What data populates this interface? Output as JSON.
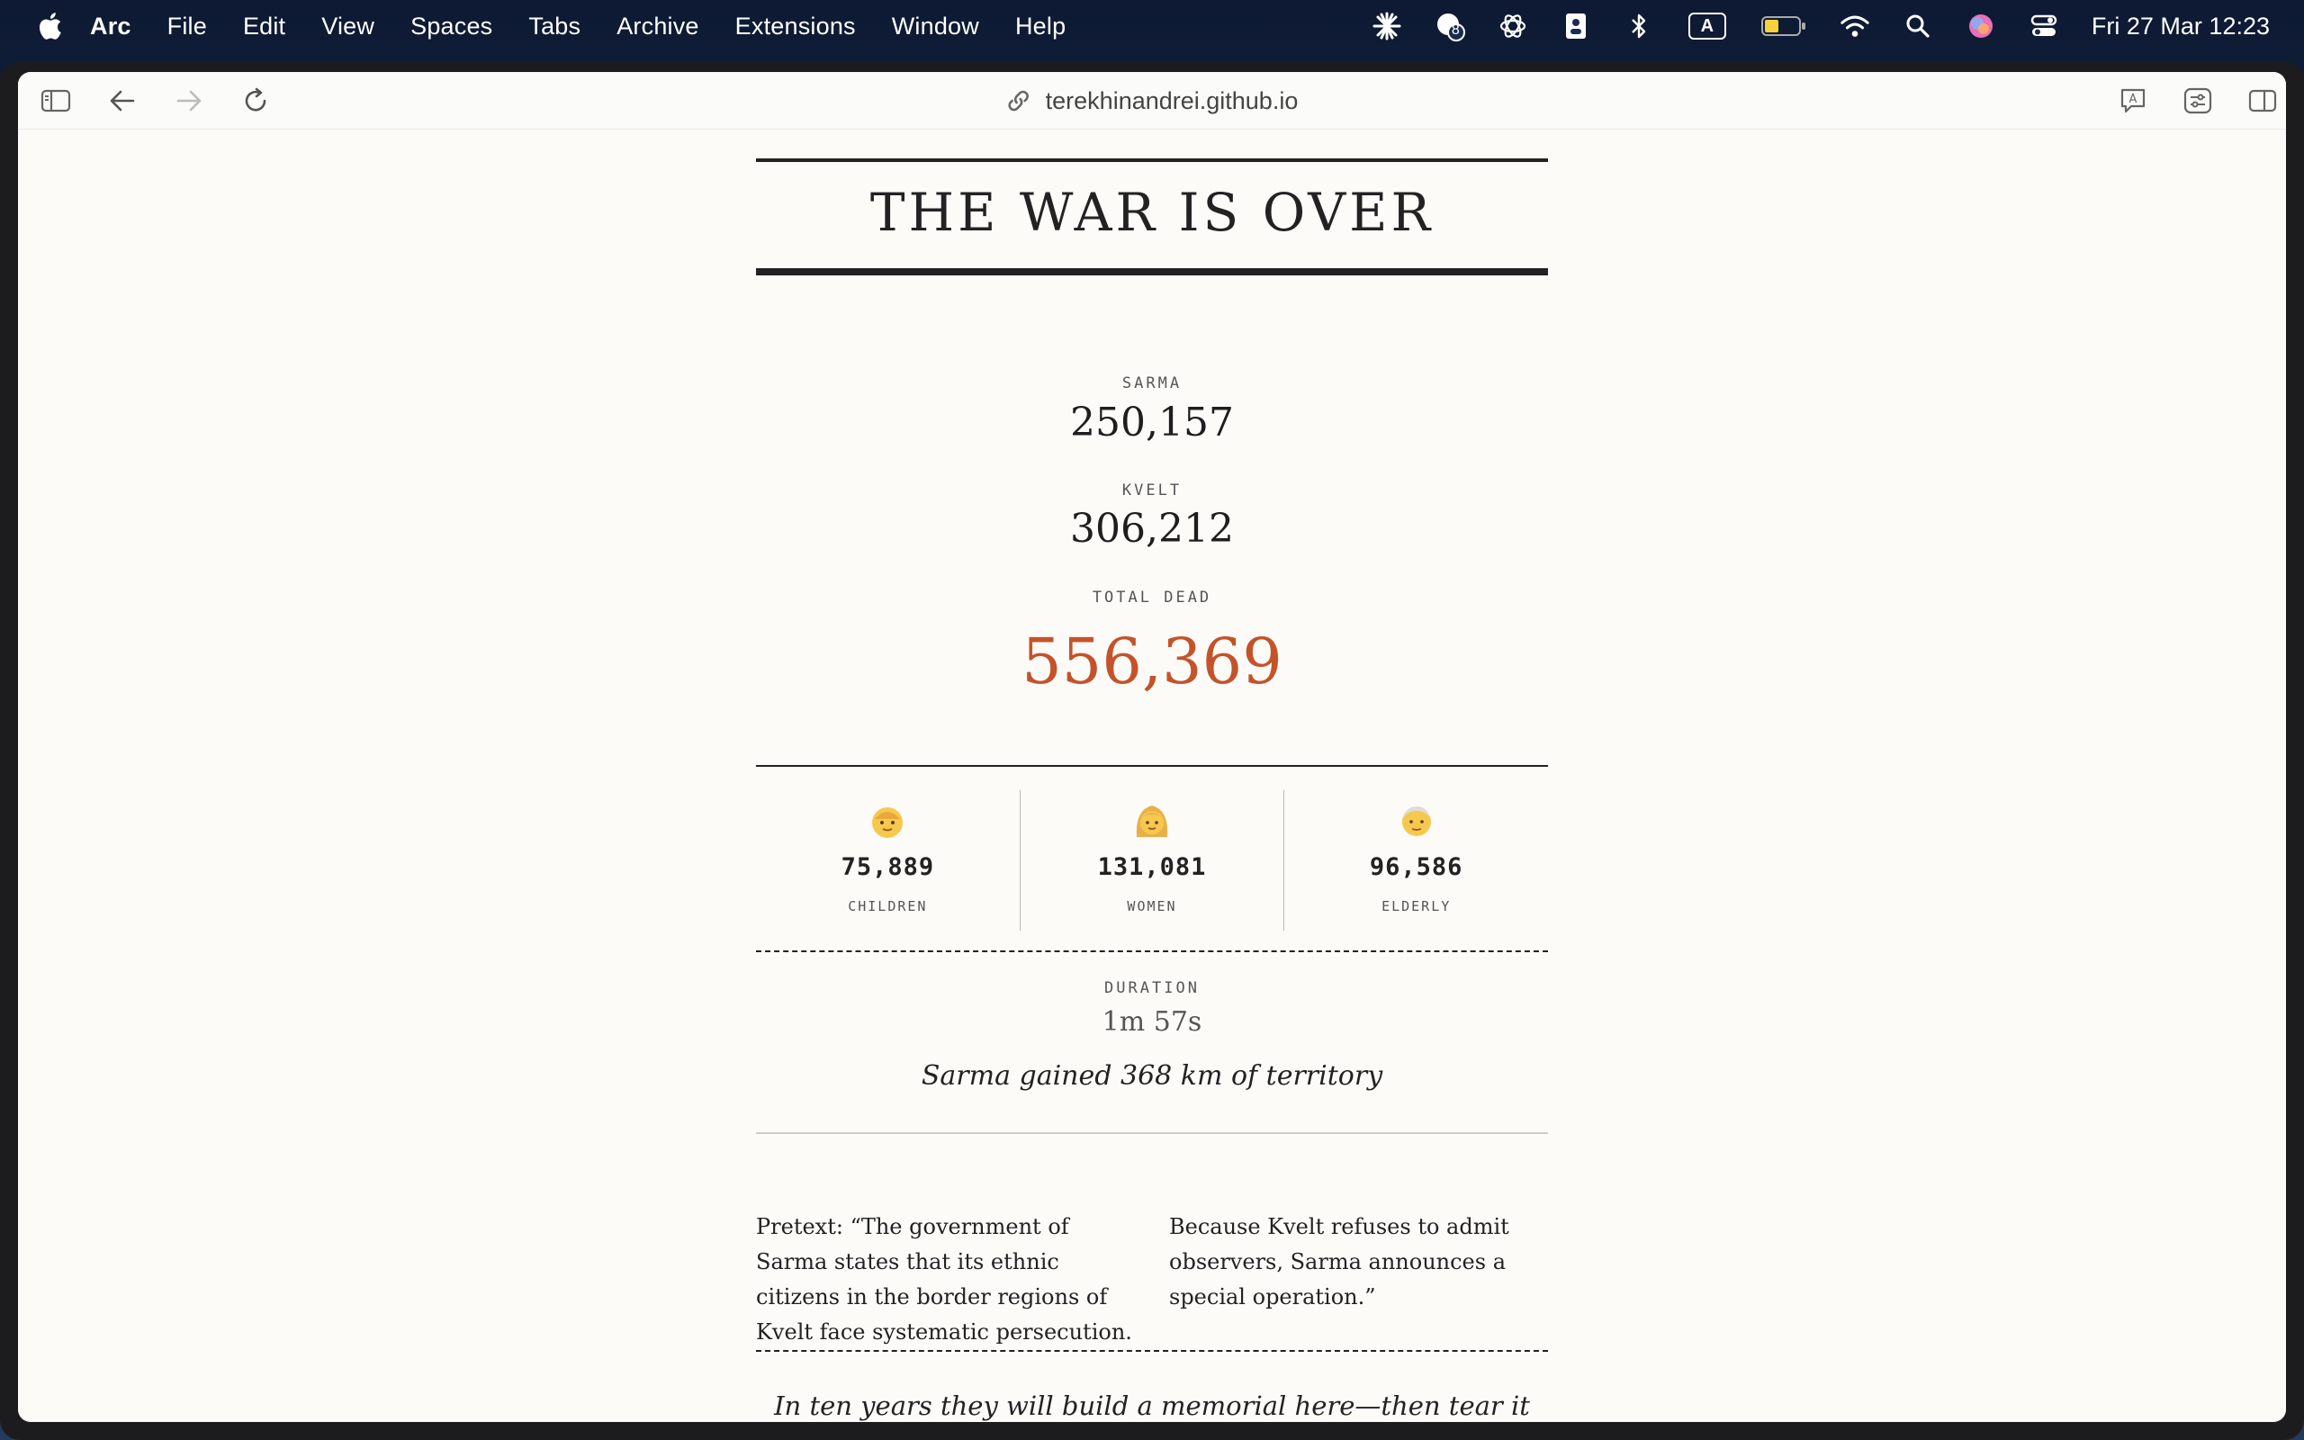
{
  "menubar": {
    "app": "Arc",
    "items": [
      "File",
      "Edit",
      "View",
      "Spaces",
      "Tabs",
      "Archive",
      "Extensions",
      "Window",
      "Help"
    ],
    "notification_badge": "8",
    "input_source": "A",
    "clock": "Fri 27 Mar  12:23"
  },
  "browser": {
    "url": "terekhinandrei.github.io"
  },
  "page": {
    "title": "THE WAR IS OVER",
    "sarma_label": "SARMA",
    "sarma_value": "250,157",
    "kvelt_label": "KVELT",
    "kvelt_value": "306,212",
    "total_label": "TOTAL DEAD",
    "total_value": "556,369",
    "accent_color": "#c4532a",
    "stats": [
      {
        "icon": "child-emoji-icon",
        "value": "75,889",
        "label": "CHILDREN"
      },
      {
        "icon": "woman-emoji-icon",
        "value": "131,081",
        "label": "WOMEN"
      },
      {
        "icon": "elderly-emoji-icon",
        "value": "96,586",
        "label": "ELDERLY"
      }
    ],
    "duration_label": "DURATION",
    "duration_value": "1m 57s",
    "territory": "Sarma gained 368 km of territory",
    "pretext": "Pretext: “The government of Sarma states that its ethnic citizens in the border regions of Kvelt face systematic persecution. Because Kvelt refuses to admit observers, Sarma announces a special operation.”",
    "closing": "In ten years they will build a memorial here—then tear it down when the next war comes."
  }
}
